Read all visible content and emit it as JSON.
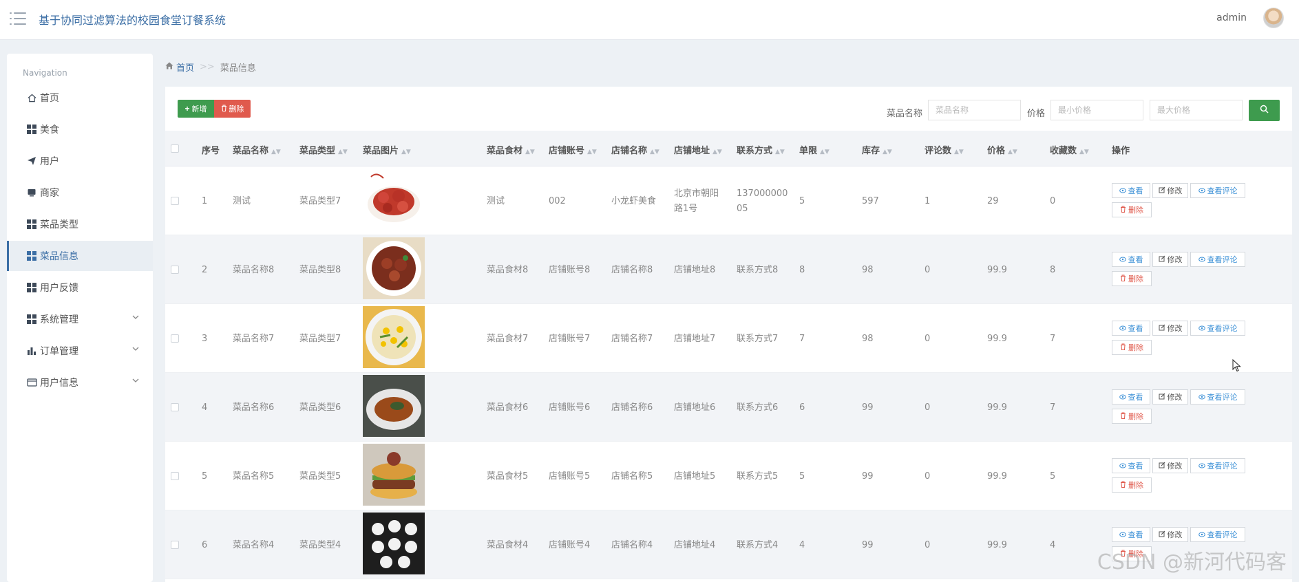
{
  "header": {
    "title": "基于协同过滤算法的校园食堂订餐系统",
    "user": "admin"
  },
  "sidebar": {
    "caption": "Navigation",
    "items": [
      {
        "label": "首页",
        "icon": "home-icon"
      },
      {
        "label": "美食",
        "icon": "grid-icon"
      },
      {
        "label": "用户",
        "icon": "paper-plane-icon"
      },
      {
        "label": "商家",
        "icon": "monitor-icon"
      },
      {
        "label": "菜品类型",
        "icon": "grid-icon"
      },
      {
        "label": "菜品信息",
        "icon": "grid-icon",
        "active": true
      },
      {
        "label": "用户反馈",
        "icon": "grid-icon"
      },
      {
        "label": "系统管理",
        "icon": "grid-icon",
        "expandable": true
      },
      {
        "label": "订单管理",
        "icon": "bar-chart-icon",
        "expandable": true
      },
      {
        "label": "用户信息",
        "icon": "card-icon",
        "expandable": true
      }
    ]
  },
  "breadcrumb": {
    "home": "首页",
    "separator": ">>",
    "current": "菜品信息"
  },
  "toolbar": {
    "add_label": "新增",
    "delete_label": "删除"
  },
  "search": {
    "name_label": "菜品名称",
    "name_placeholder": "菜品名称",
    "price_label": "价格",
    "min_placeholder": "最小价格",
    "max_placeholder": "最大价格"
  },
  "table": {
    "headers": [
      "序号",
      "菜品名称",
      "菜品类型",
      "菜品图片",
      "菜品食材",
      "店铺账号",
      "店铺名称",
      "店铺地址",
      "联系方式",
      "单限",
      "库存",
      "评论数",
      "价格",
      "收藏数",
      "操作"
    ],
    "rows": [
      {
        "no": "1",
        "name": "测试",
        "type": "菜品类型7",
        "food": "测试",
        "account": "002",
        "shop": "小龙虾美食",
        "addr": [
          "北京市朝阳",
          "路1号"
        ],
        "phone": [
          "137000000",
          "05"
        ],
        "limit": "5",
        "stock": "597",
        "comments": "1",
        "price": "29",
        "fav": "0"
      },
      {
        "no": "2",
        "name": "菜品名称8",
        "type": "菜品类型8",
        "food": "菜品食材8",
        "account": "店铺账号8",
        "shop": "店铺名称8",
        "addr": [
          "店铺地址8"
        ],
        "phone": [
          "联系方式8"
        ],
        "limit": "8",
        "stock": "98",
        "comments": "0",
        "price": "99.9",
        "fav": "8"
      },
      {
        "no": "3",
        "name": "菜品名称7",
        "type": "菜品类型7",
        "food": "菜品食材7",
        "account": "店铺账号7",
        "shop": "店铺名称7",
        "addr": [
          "店铺地址7"
        ],
        "phone": [
          "联系方式7"
        ],
        "limit": "7",
        "stock": "98",
        "comments": "0",
        "price": "99.9",
        "fav": "7"
      },
      {
        "no": "4",
        "name": "菜品名称6",
        "type": "菜品类型6",
        "food": "菜品食材6",
        "account": "店铺账号6",
        "shop": "店铺名称6",
        "addr": [
          "店铺地址6"
        ],
        "phone": [
          "联系方式6"
        ],
        "limit": "6",
        "stock": "99",
        "comments": "0",
        "price": "99.9",
        "fav": "7"
      },
      {
        "no": "5",
        "name": "菜品名称5",
        "type": "菜品类型5",
        "food": "菜品食材5",
        "account": "店铺账号5",
        "shop": "店铺名称5",
        "addr": [
          "店铺地址5"
        ],
        "phone": [
          "联系方式5"
        ],
        "limit": "5",
        "stock": "99",
        "comments": "0",
        "price": "99.9",
        "fav": "5"
      },
      {
        "no": "6",
        "name": "菜品名称4",
        "type": "菜品类型4",
        "food": "菜品食材4",
        "account": "店铺账号4",
        "shop": "店铺名称4",
        "addr": [
          "店铺地址4"
        ],
        "phone": [
          "联系方式4"
        ],
        "limit": "4",
        "stock": "99",
        "comments": "0",
        "price": "99.9",
        "fav": "4"
      }
    ],
    "actions": {
      "view": "查看",
      "edit": "修改",
      "view_comments": "查看评论",
      "delete": "删除"
    }
  },
  "watermark": "CSDN @新河代码客",
  "colors": {
    "accent": "#3b6ea5",
    "success": "#3e9b4e",
    "danger": "#e05a4d",
    "link": "#3a8fd6"
  }
}
